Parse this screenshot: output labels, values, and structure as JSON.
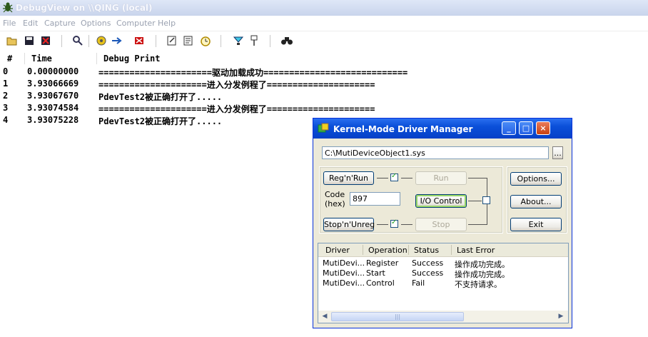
{
  "window": {
    "title": "DebugView on \\\\QING (local)"
  },
  "menu": [
    "File",
    "Edit",
    "Capture",
    "Options",
    "Computer",
    "Help"
  ],
  "toolbar_icons": [
    "open-icon",
    "save-icon",
    "clear-icon",
    "find-icon",
    "capture-icon",
    "autoscroll-icon",
    "filter-icon",
    "edit-icon",
    "properties-icon",
    "clock-icon",
    "highlight-icon",
    "pin-icon",
    "binoculars-icon"
  ],
  "columns": [
    "#",
    "Time",
    "Debug Print"
  ],
  "log_rows": [
    {
      "num": "0",
      "time": "0.00000000",
      "msg": "======================驱动加载成功============================"
    },
    {
      "num": "1",
      "time": "3.93066669",
      "msg": "=====================进入分发例程了====================="
    },
    {
      "num": "2",
      "time": "3.93067670",
      "msg": "PdevTest2被正确打开了....."
    },
    {
      "num": "3",
      "time": "3.93074584",
      "msg": "=====================进入分发例程了====================="
    },
    {
      "num": "4",
      "time": "3.93075228",
      "msg": "PdevTest2被正确打开了....."
    }
  ],
  "dialog": {
    "title": "Kernel-Mode Driver Manager",
    "path": "C:\\MutiDeviceObject1.sys",
    "browse_label": "...",
    "reg_run": "Reg'n'Run",
    "run": "Run",
    "code_label_1": "Code",
    "code_label_2": "(hex)",
    "code_value": "897",
    "io_control": "I/O Control",
    "stop_unreg": "Stop'n'Unreg",
    "stop": "Stop",
    "options": "Options...",
    "about": "About...",
    "exit": "Exit",
    "list_columns": [
      "Driver",
      "Operation",
      "Status",
      "Last Error"
    ],
    "list_rows": [
      {
        "driver": "MutiDevi...",
        "operation": "Register",
        "status": "Success",
        "error": "操作成功完成。"
      },
      {
        "driver": "MutiDevi...",
        "operation": "Start",
        "status": "Success",
        "error": "操作成功完成。"
      },
      {
        "driver": "MutiDevi...",
        "operation": "Control",
        "status": "Fail",
        "error": "不支持请求。"
      }
    ]
  },
  "colors": {
    "dialog_title": "#0a4fd8",
    "dialog_bg": "#ece9d8"
  }
}
